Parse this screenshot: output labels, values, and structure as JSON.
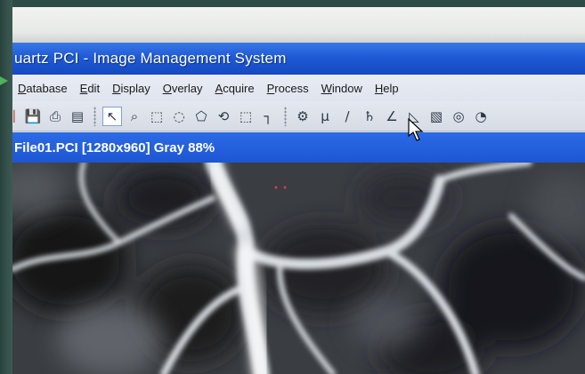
{
  "window": {
    "title": "Quartz PCI - Image Management System",
    "title_visible": "uartz PCI - Image Management System"
  },
  "menu": {
    "items": [
      {
        "pre": "",
        "mn": "D",
        "post": "atabase"
      },
      {
        "pre": "",
        "mn": "E",
        "post": "dit"
      },
      {
        "pre": "",
        "mn": "D",
        "post": "isplay"
      },
      {
        "pre": "",
        "mn": "O",
        "post": "verlay"
      },
      {
        "pre": "",
        "mn": "A",
        "post": "cquire"
      },
      {
        "pre": "",
        "mn": "P",
        "post": "rocess"
      },
      {
        "pre": "",
        "mn": "W",
        "post": "indow"
      },
      {
        "pre": "",
        "mn": "H",
        "post": "elp"
      }
    ]
  },
  "toolbar": {
    "icons": [
      {
        "name": "save-icon",
        "glyph": "💾"
      },
      {
        "name": "print-icon",
        "glyph": "⎙"
      },
      {
        "name": "properties-icon",
        "glyph": "▤"
      },
      {
        "name": "separator"
      },
      {
        "name": "select-arrow-icon",
        "glyph": "↖",
        "active": true
      },
      {
        "name": "zoom-icon",
        "glyph": "⌕"
      },
      {
        "name": "rectangle-select-icon",
        "glyph": "⬚"
      },
      {
        "name": "ellipse-select-icon",
        "glyph": "◌"
      },
      {
        "name": "polygon-select-icon",
        "glyph": "⬠"
      },
      {
        "name": "freehand-select-icon",
        "glyph": "⟲"
      },
      {
        "name": "marquee-select-icon",
        "glyph": "⬚"
      },
      {
        "name": "crosshair-icon",
        "glyph": "┐"
      },
      {
        "name": "separator"
      },
      {
        "name": "calibrate-icon",
        "glyph": "⚙"
      },
      {
        "name": "micron-icon",
        "glyph": "μ"
      },
      {
        "name": "ruler-icon",
        "glyph": "∕"
      },
      {
        "name": "caliper-icon",
        "glyph": "♄"
      },
      {
        "name": "angle-icon",
        "glyph": "∠"
      },
      {
        "name": "angle-measure-icon",
        "glyph": "◺"
      },
      {
        "name": "area-measure-icon",
        "glyph": "▧"
      },
      {
        "name": "circle-measure-icon",
        "glyph": "◎"
      },
      {
        "name": "more-tools-icon",
        "glyph": "◔"
      }
    ]
  },
  "document": {
    "title": "File01.PCI [1280x960] Gray 88%"
  },
  "colors": {
    "titlebar": "#1f5ad6",
    "docbar": "#1e56d2",
    "menubar": "#e4e8f0",
    "image_bg": "#2a2c30"
  }
}
